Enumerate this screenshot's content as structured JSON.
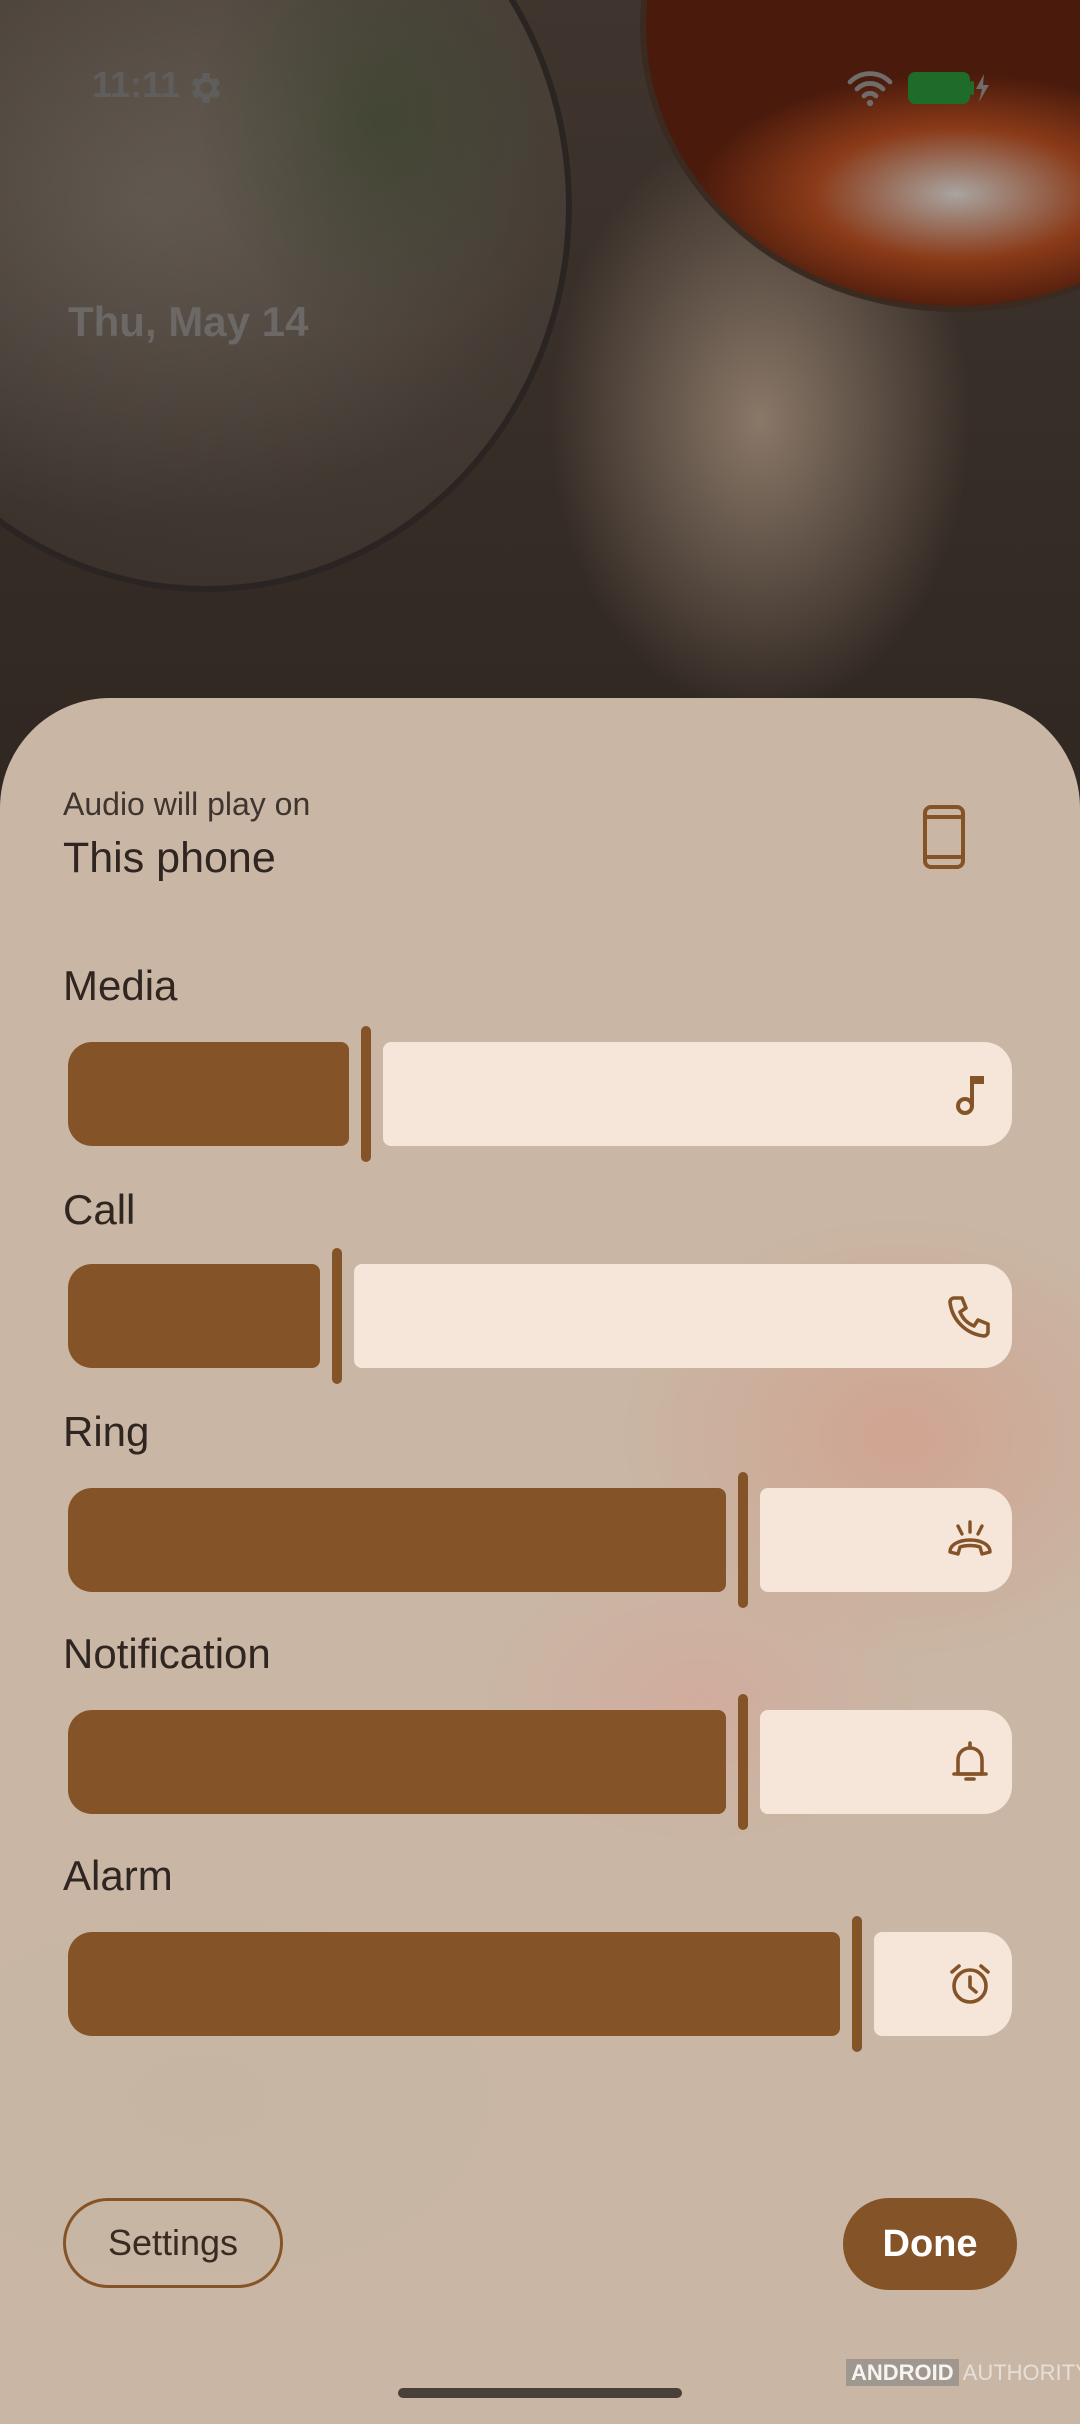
{
  "status_bar": {
    "time": "11:11",
    "battery_color": "#1e6b2a",
    "icons": [
      "gear-icon",
      "wifi-icon",
      "battery-charging-icon"
    ]
  },
  "lock_screen": {
    "date": "Thu, May 14"
  },
  "volume_panel": {
    "output": {
      "label": "Audio will play on",
      "device": "This phone",
      "icon": "phone-icon"
    },
    "streams": [
      {
        "label": "Media",
        "level_fraction": 0.31,
        "icon": "music-note-icon"
      },
      {
        "label": "Call",
        "level_fraction": 0.28,
        "icon": "phone-call-icon"
      },
      {
        "label": "Ring",
        "level_fraction": 0.71,
        "icon": "ring-icon"
      },
      {
        "label": "Notification",
        "level_fraction": 0.71,
        "icon": "bell-icon"
      },
      {
        "label": "Alarm",
        "level_fraction": 0.83,
        "icon": "alarm-clock-icon"
      }
    ],
    "settings_label": "Settings",
    "done_label": "Done"
  },
  "watermark": {
    "boxed": "ANDROID",
    "rest": "AUTHORITY"
  },
  "colors": {
    "accent": "#845428",
    "track": "#f6e6d9",
    "panel": "#c9b6a4"
  }
}
